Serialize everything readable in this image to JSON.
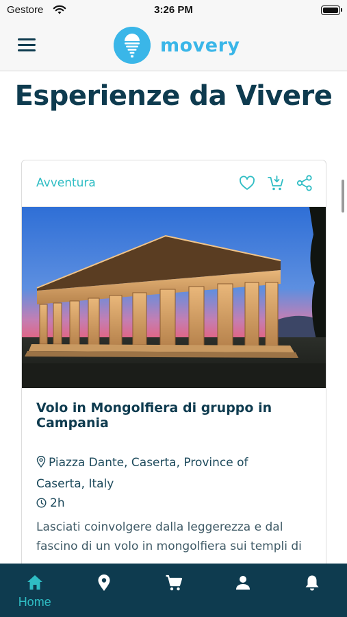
{
  "status_bar": {
    "carrier": "Gestore",
    "time": "3:26 PM"
  },
  "header": {
    "logo_text": "movery"
  },
  "page": {
    "title": "Esperienze da Vivere"
  },
  "card": {
    "category": "Avventura",
    "title": "Volo in Mongolfiera di gruppo in Campania",
    "location": "Piazza Dante, Caserta, Province of Caserta, Italy",
    "duration": "2h",
    "description": " Lasciati coinvolgere dalla leggerezza e dal fascino di un volo in mongolfiera sui templi di"
  },
  "tab_bar": {
    "tabs": [
      {
        "icon": "home-icon",
        "label": "Home",
        "active": true
      },
      {
        "icon": "location-icon",
        "label": "",
        "active": false
      },
      {
        "icon": "cart-icon",
        "label": "",
        "active": false
      },
      {
        "icon": "profile-icon",
        "label": "",
        "active": false
      },
      {
        "icon": "bell-icon",
        "label": "",
        "active": false
      }
    ]
  },
  "colors": {
    "brand": "#3ab6e8",
    "navy": "#0e3b4f",
    "accent": "#2fbdc4"
  }
}
